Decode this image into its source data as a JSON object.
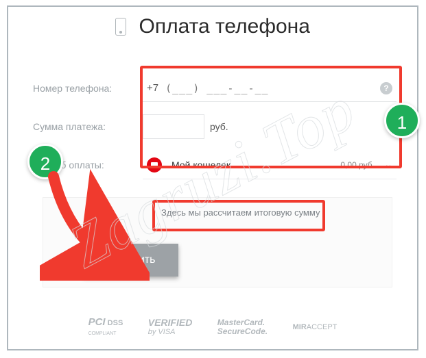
{
  "title": "Оплата телефона",
  "labels": {
    "phone": "Номер телефона:",
    "amount": "Сумма платежа:",
    "method": "Способ оплаты:"
  },
  "phone": {
    "prefix": "+7",
    "mask": "(___) ___-__-__",
    "help": "?"
  },
  "currency": "руб.",
  "wallet": {
    "name": "Мой кошелек",
    "balance": "0,00 руб."
  },
  "calc_message": "Здесь мы рассчитаем итоговую сумму",
  "pay_button": "Оплатить",
  "steps": {
    "one": "1",
    "two": "2"
  },
  "footer": {
    "pci_a": "PCI",
    "pci_b": "DSS",
    "pci_c": "COMPLIANT",
    "verified_a": "VERIFIED",
    "verified_b": "by VISA",
    "mc_a": "MasterCard.",
    "mc_b": "SecureCode.",
    "mir_a": "MIR",
    "mir_b": "ACCEPT"
  },
  "watermark": "Zagruzi.Top"
}
